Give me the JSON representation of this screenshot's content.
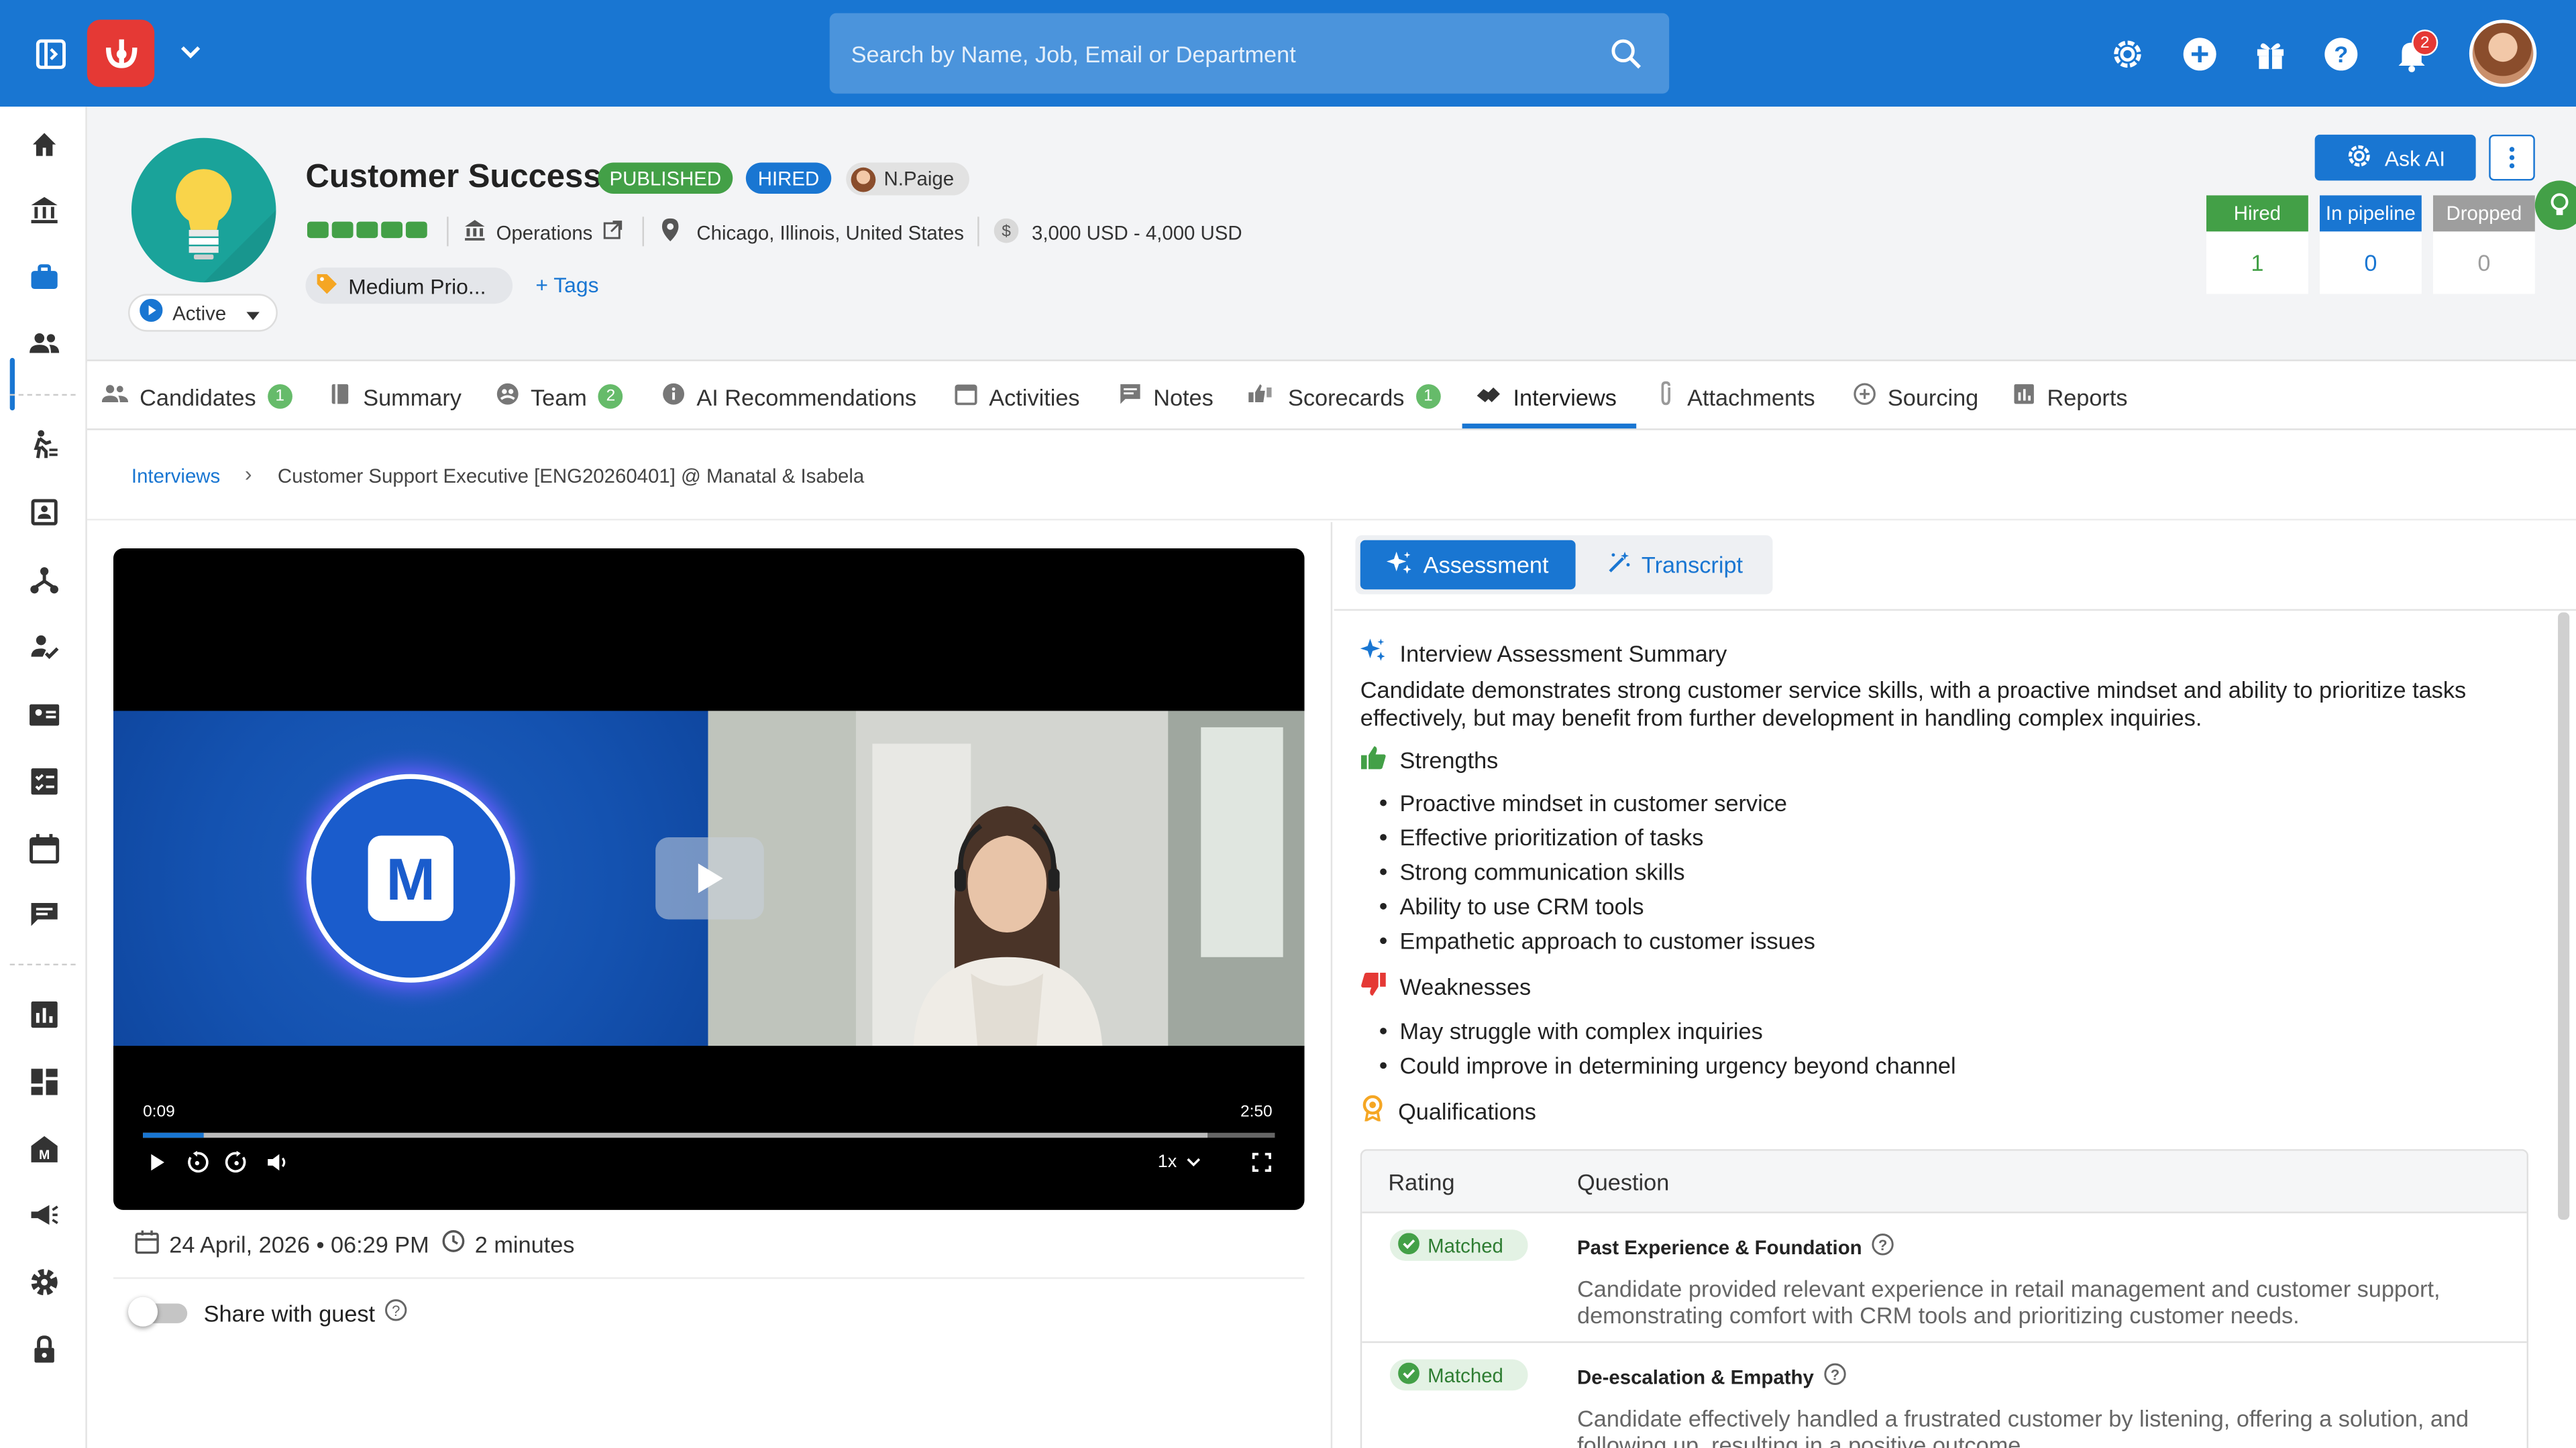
{
  "topbar": {
    "search_placeholder": "Search by Name, Job, Email or Department",
    "notification_count": "2"
  },
  "job": {
    "title": "Customer Success",
    "status_published": "PUBLISHED",
    "status_hired": "HIRED",
    "owner": "N.Paige",
    "department": "Operations",
    "location": "Chicago, Illinois, United States",
    "salary": "3,000 USD - 4,000 USD",
    "priority": "Medium Prio...",
    "tags_label": "Tags",
    "state": "Active",
    "ask_ai_label": "Ask AI",
    "stats": [
      {
        "label": "Hired",
        "value": "1",
        "color": "#43a047"
      },
      {
        "label": "In pipeline",
        "value": "0",
        "color": "#1976d2"
      },
      {
        "label": "Dropped",
        "value": "0",
        "color": "#9e9e9e"
      }
    ]
  },
  "tabs": [
    {
      "label": "Candidates",
      "badge": "1"
    },
    {
      "label": "Summary"
    },
    {
      "label": "Team",
      "badge": "2"
    },
    {
      "label": "AI Recommendations"
    },
    {
      "label": "Activities"
    },
    {
      "label": "Notes"
    },
    {
      "label": "Scorecards",
      "badge": "1"
    },
    {
      "label": "Interviews"
    },
    {
      "label": "Attachments"
    },
    {
      "label": "Sourcing"
    },
    {
      "label": "Reports"
    }
  ],
  "breadcrumb": {
    "parent": "Interviews",
    "current": "Customer Support Executive [ENG20260401] @ Manatal & Isabela"
  },
  "video": {
    "current_time": "0:09",
    "duration": "2:50",
    "progress": 0.053,
    "speed": "1x",
    "date": "24 April, 2026 • 06:29 PM",
    "length": "2 minutes",
    "share_label": "Share with guest"
  },
  "assessment": {
    "tab_assessment": "Assessment",
    "tab_transcript": "Transcript",
    "summary_title": "Interview Assessment Summary",
    "summary_text": "Candidate demonstrates strong customer service skills, with a proactive mindset and ability to prioritize tasks effectively, but may benefit from further development in handling complex inquiries.",
    "strengths_title": "Strengths",
    "strengths": [
      "Proactive mindset in customer service",
      "Effective prioritization of tasks",
      "Strong communication skills",
      "Ability to use CRM tools",
      "Empathetic approach to customer issues"
    ],
    "weaknesses_title": "Weaknesses",
    "weaknesses": [
      "May struggle with complex inquiries",
      "Could improve in determining urgency beyond channel"
    ],
    "qualifications_title": "Qualifications",
    "table_headers": {
      "rating": "Rating",
      "question": "Question"
    },
    "rows": [
      {
        "rating": "Matched",
        "question": "Past Experience & Foundation",
        "answer": "Candidate provided relevant experience in retail management and customer support, demonstrating comfort with CRM tools and prioritizing customer needs."
      },
      {
        "rating": "Matched",
        "question": "De-escalation & Empathy",
        "answer": "Candidate effectively handled a frustrated customer by listening, offering a solution, and following up, resulting in a positive outcome."
      }
    ]
  }
}
